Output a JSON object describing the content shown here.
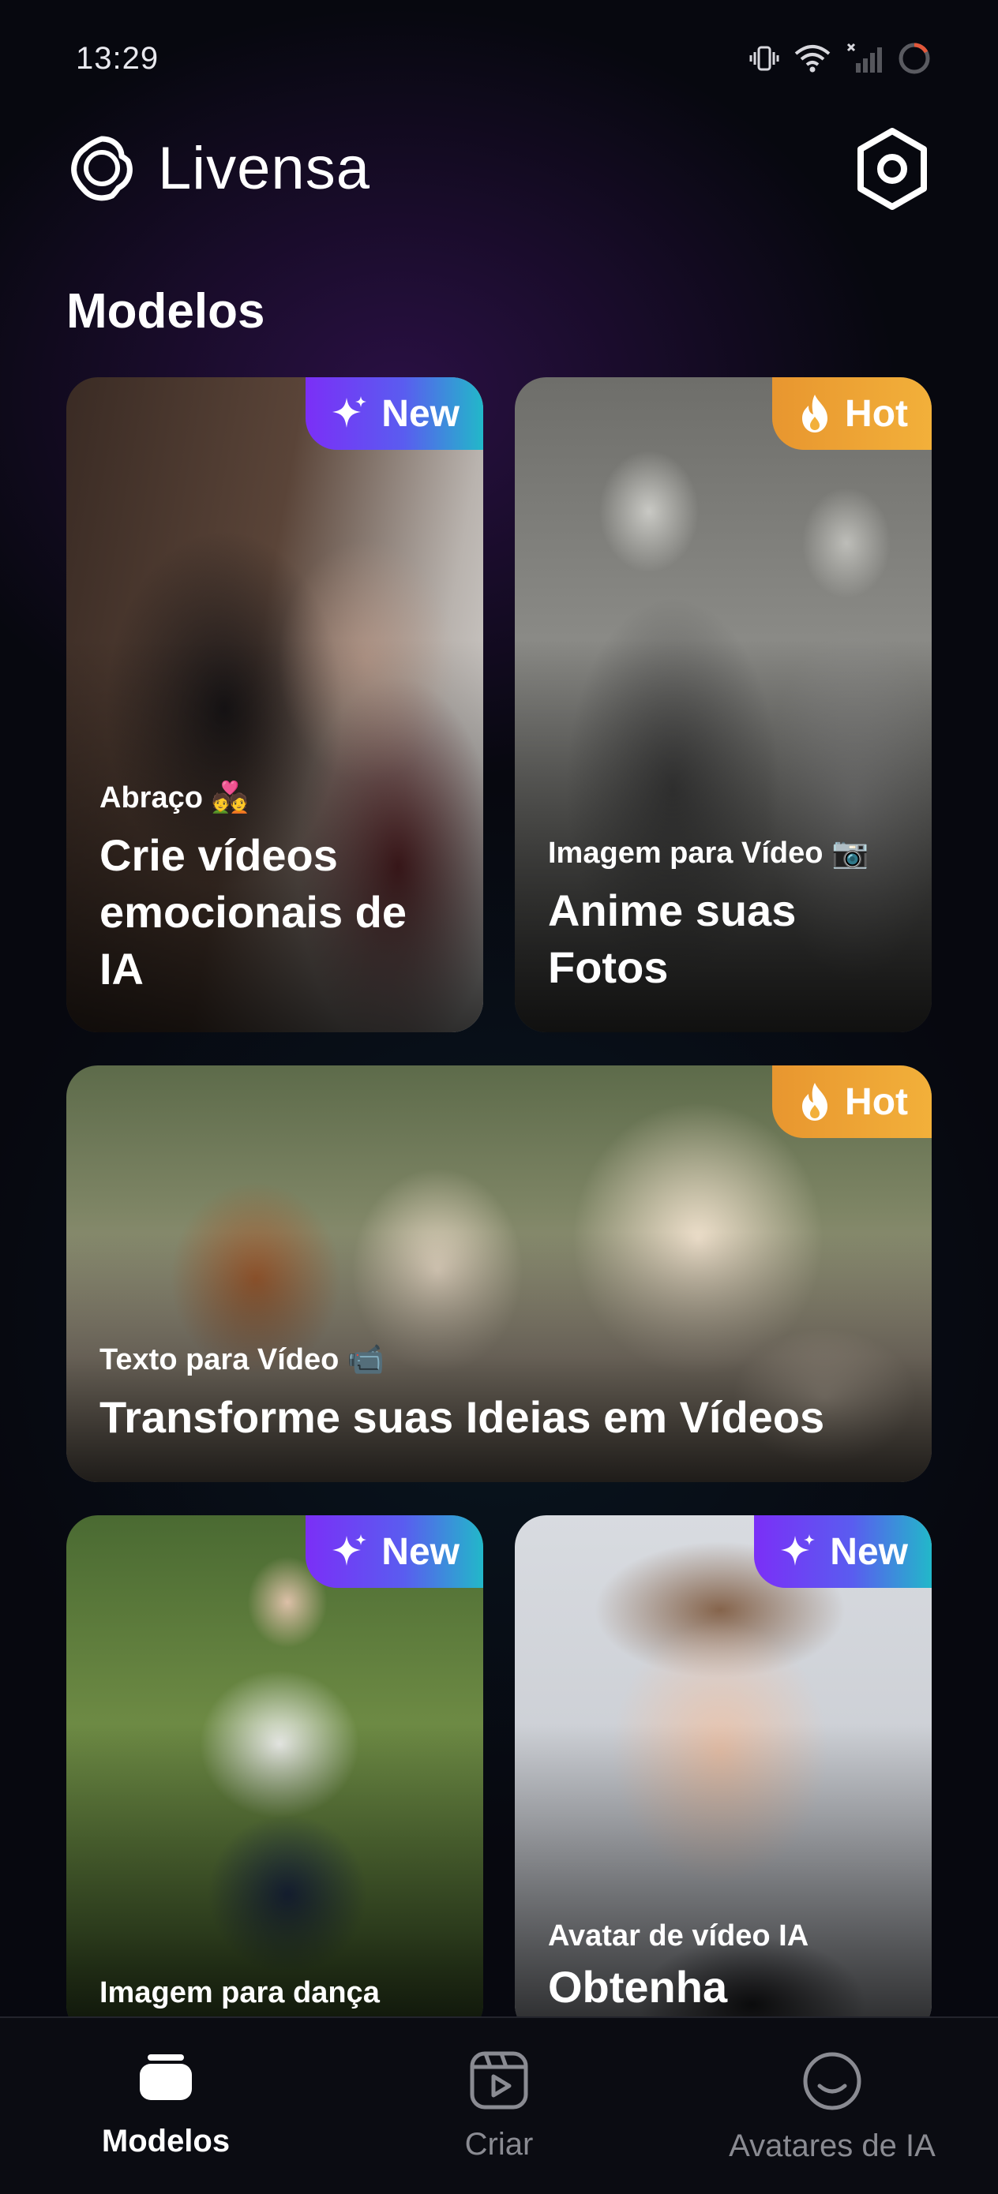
{
  "status_bar": {
    "time": "13:29"
  },
  "header": {
    "app_name": "Livensa"
  },
  "section": {
    "title": "Modelos"
  },
  "cards": [
    {
      "badge": "New",
      "badge_type": "new",
      "subtitle": "Abraço 💑",
      "title": "Crie vídeos emocionais de IA"
    },
    {
      "badge": "Hot",
      "badge_type": "hot",
      "subtitle": "Imagem para Vídeo 📷",
      "title": "Anime suas Fotos"
    },
    {
      "badge": "Hot",
      "badge_type": "hot",
      "subtitle": "Texto para Vídeo 📹",
      "title": "Transforme suas Ideias em Vídeos"
    },
    {
      "badge": "New",
      "badge_type": "new",
      "subtitle": "Imagem para dança",
      "title": ""
    },
    {
      "badge": "New",
      "badge_type": "new",
      "subtitle": "Avatar de vídeo IA",
      "title": "Obtenha"
    }
  ],
  "bottom_nav": [
    {
      "label": "Modelos",
      "icon": "templates-icon",
      "active": true
    },
    {
      "label": "Criar",
      "icon": "create-video-icon",
      "active": false
    },
    {
      "label": "Avatares de IA",
      "icon": "avatar-smile-icon",
      "active": false
    }
  ],
  "colors": {
    "background": "#07080f",
    "badge_new": "#7b2ff7",
    "badge_hot": "#f2b03a",
    "nav_inactive": "#8a8b92"
  }
}
